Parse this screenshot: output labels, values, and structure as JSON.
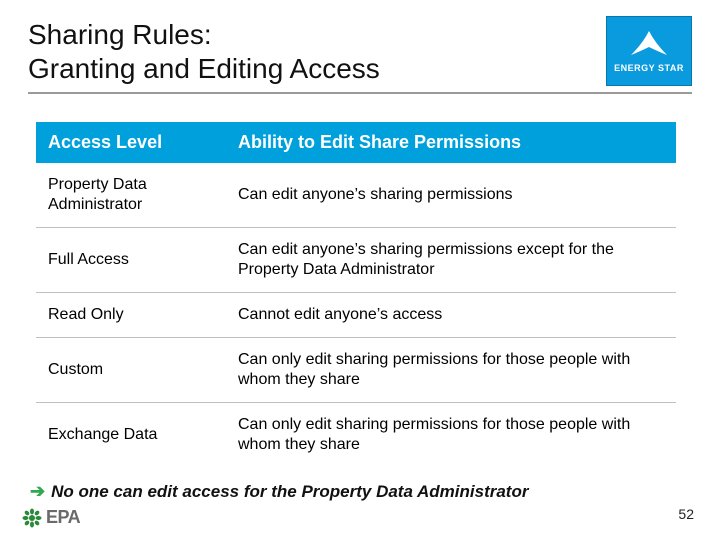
{
  "header": {
    "title_line1": "Sharing Rules:",
    "title_line2": "Granting and Editing Access"
  },
  "logo_energy_star": {
    "label": "ENERGY STAR"
  },
  "table": {
    "headers": {
      "col1": "Access Level",
      "col2": "Ability to Edit Share Permissions"
    },
    "rows": [
      {
        "level": "Property Data Administrator",
        "ability": "Can edit anyone’s sharing permissions"
      },
      {
        "level": "Full Access",
        "ability": "Can edit anyone’s sharing permissions except for the Property Data Administrator"
      },
      {
        "level": "Read Only",
        "ability": "Cannot edit anyone’s access"
      },
      {
        "level": "Custom",
        "ability": "Can only edit sharing permissions for those people with whom they share"
      },
      {
        "level": "Exchange Data",
        "ability": "Can only edit sharing permissions for those people with whom they share"
      }
    ]
  },
  "footnote": {
    "arrow": "➔",
    "text": "No one can edit access for the Property Data Administrator"
  },
  "page_number": "52",
  "epa_logo": {
    "label": "EPA"
  }
}
